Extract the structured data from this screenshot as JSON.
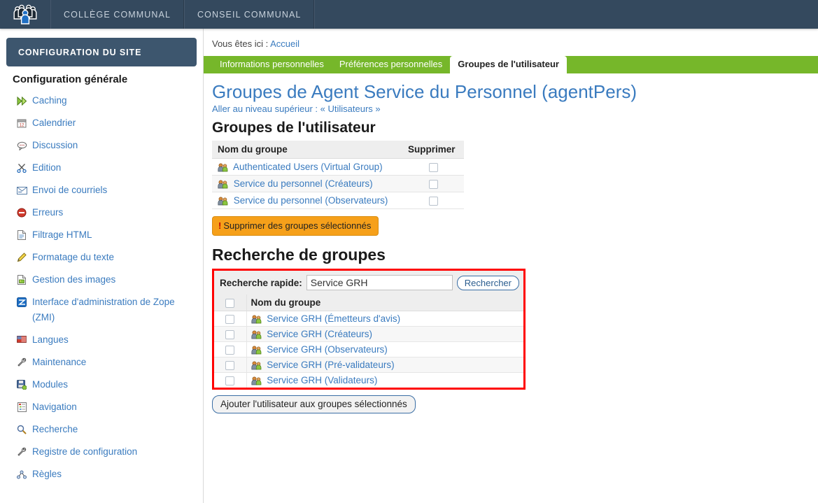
{
  "topbar": {
    "logo_icon": "group-people-logo-icon",
    "nav": [
      {
        "label": "COLLÈGE COMMUNAL"
      },
      {
        "label": "CONSEIL COMMUNAL"
      }
    ]
  },
  "sidebar": {
    "header": "CONFIGURATION DU SITE",
    "section_title": "Configuration générale",
    "items": [
      {
        "label": "Caching",
        "icon": "fast-forward-icon"
      },
      {
        "label": "Calendrier",
        "icon": "calendar-icon"
      },
      {
        "label": "Discussion",
        "icon": "speech-bubble-icon"
      },
      {
        "label": "Edition",
        "icon": "scissors-icon"
      },
      {
        "label": "Envoi de courriels",
        "icon": "envelope-icon"
      },
      {
        "label": "Erreurs",
        "icon": "error-circle-icon"
      },
      {
        "label": "Filtrage HTML",
        "icon": "document-icon"
      },
      {
        "label": "Formatage du texte",
        "icon": "pencil-icon"
      },
      {
        "label": "Gestion des images",
        "icon": "image-document-icon"
      },
      {
        "label": "Interface d'administration de Zope (ZMI)",
        "icon": "zope-icon"
      },
      {
        "label": "Langues",
        "icon": "flag-icon"
      },
      {
        "label": "Maintenance",
        "icon": "wrench-icon"
      },
      {
        "label": "Modules",
        "icon": "disk-icon"
      },
      {
        "label": "Navigation",
        "icon": "tree-list-icon"
      },
      {
        "label": "Recherche",
        "icon": "magnifier-icon"
      },
      {
        "label": "Registre de configuration",
        "icon": "wrench-icon"
      },
      {
        "label": "Règles",
        "icon": "rules-node-icon"
      }
    ]
  },
  "main": {
    "breadcrumb_prefix": "Vous êtes ici :",
    "breadcrumb_link": "Accueil",
    "tabs": [
      {
        "label": "Informations personnelles",
        "selected": false
      },
      {
        "label": "Préférences personnelles",
        "selected": false
      },
      {
        "label": "Groupes de l'utilisateur",
        "selected": true
      }
    ],
    "page_title": "Groupes de Agent Service du Personnel (agentPers)",
    "up_level_prefix": "Aller au niveau supérieur :",
    "up_level_link": "« Utilisateurs »",
    "user_groups": {
      "heading": "Groupes de l'utilisateur",
      "columns": [
        "Nom du groupe",
        "Supprimer"
      ],
      "rows": [
        {
          "name": "Authenticated Users (Virtual Group)",
          "icon": "group-icon",
          "checked": false
        },
        {
          "name": "Service du personnel (Créateurs)",
          "icon": "group-icon",
          "checked": false
        },
        {
          "name": "Service du personnel (Observateurs)",
          "icon": "group-icon",
          "checked": false
        }
      ],
      "delete_button": "Supprimer des groupes sélectionnés",
      "delete_button_marker": "!"
    },
    "group_search": {
      "heading": "Recherche de groupes",
      "quick_search_label": "Recherche rapide:",
      "search_value": "Service GRH",
      "search_button": "Rechercher",
      "column_name": "Nom du groupe",
      "select_all_checked": false,
      "rows": [
        {
          "name": "Service GRH (Émetteurs d'avis)",
          "icon": "group-icon",
          "checked": false
        },
        {
          "name": "Service GRH (Créateurs)",
          "icon": "group-icon",
          "checked": false
        },
        {
          "name": "Service GRH (Observateurs)",
          "icon": "group-icon",
          "checked": false
        },
        {
          "name": "Service GRH (Pré-validateurs)",
          "icon": "group-icon",
          "checked": false
        },
        {
          "name": "Service GRH (Validateurs)",
          "icon": "group-icon",
          "checked": false
        }
      ],
      "add_button": "Ajouter l'utilisateur aux groupes sélectionnés",
      "highlight_color": "#ff0000"
    }
  },
  "colors": {
    "topbar": "#34495e",
    "tabbar_green": "#76b72a",
    "link_blue": "#3a7bbf",
    "orange_button": "#f6a01a",
    "highlight_red": "#ff0000"
  }
}
